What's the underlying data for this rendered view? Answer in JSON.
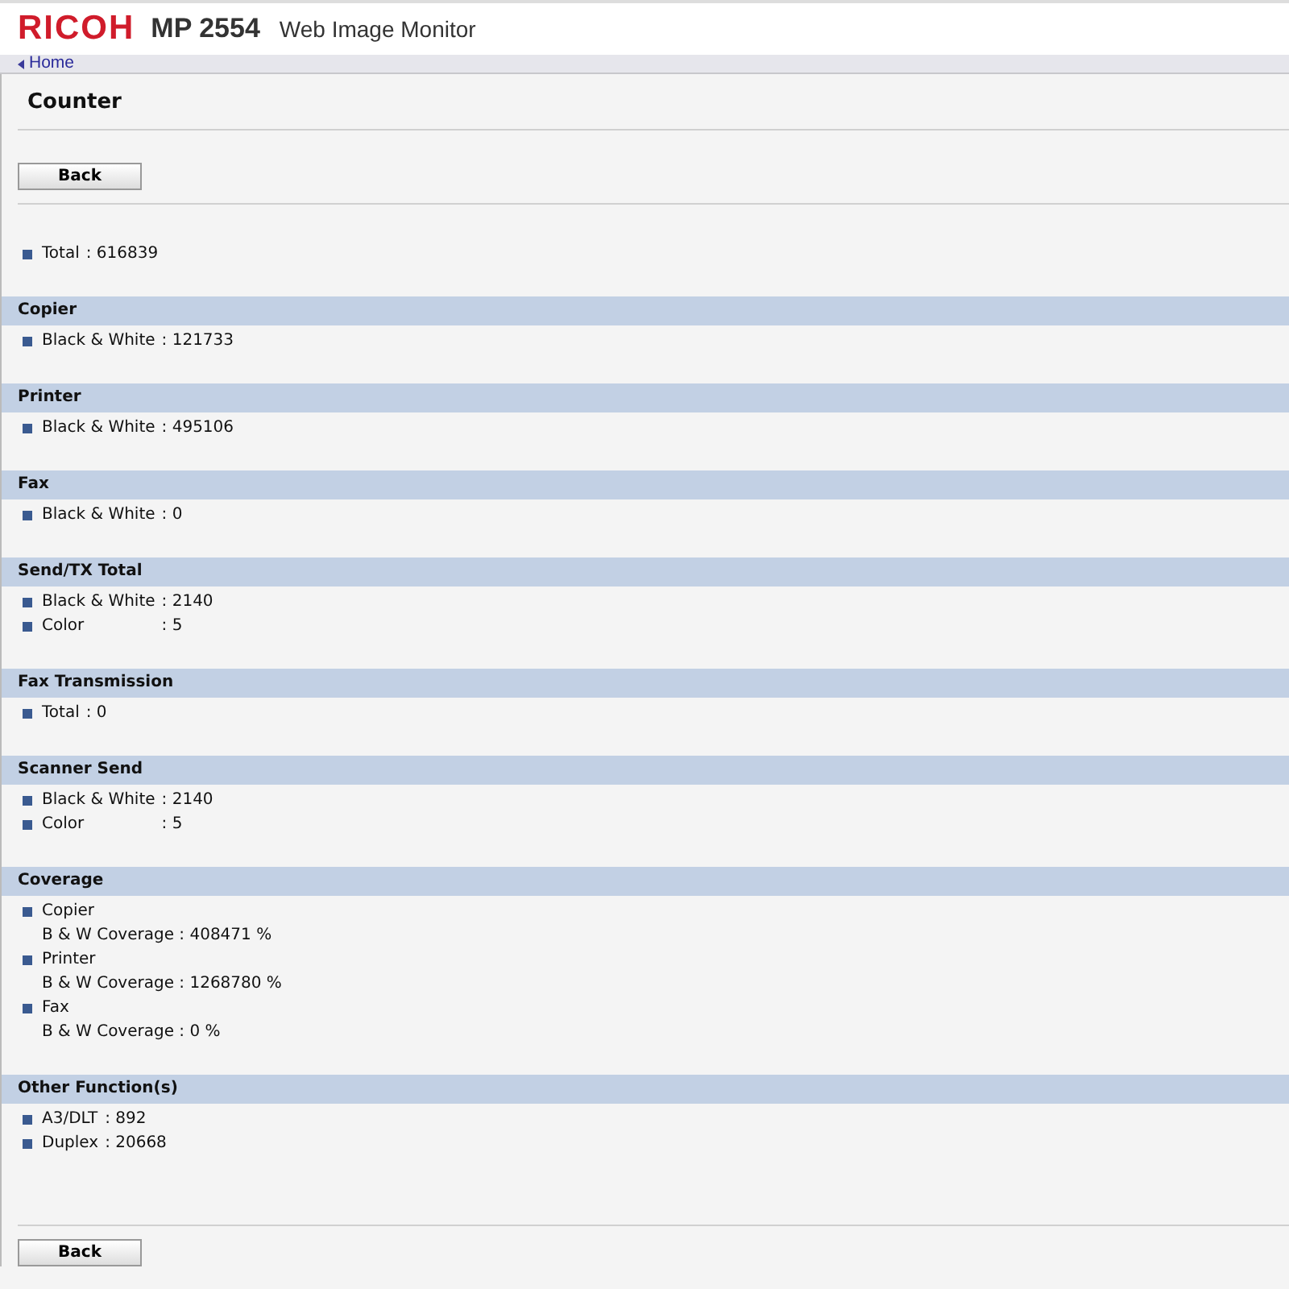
{
  "header": {
    "brand": "RICOH",
    "model": "MP 2554",
    "product": "Web Image Monitor"
  },
  "breadcrumb": {
    "link": "Home"
  },
  "page_title": "Counter",
  "back_button": "Back",
  "total": {
    "label": "Total",
    "value": ": 616839"
  },
  "sections": [
    {
      "title": "Copier",
      "items": [
        {
          "kind": "counter",
          "label": "Black & White",
          "value": ": 121733"
        }
      ]
    },
    {
      "title": "Printer",
      "items": [
        {
          "kind": "counter",
          "label": "Black & White",
          "value": ": 495106"
        }
      ]
    },
    {
      "title": "Fax",
      "items": [
        {
          "kind": "counter",
          "label": "Black & White",
          "value": ": 0"
        }
      ]
    },
    {
      "title": "Send/TX Total",
      "items": [
        {
          "kind": "counter",
          "label": "Black & White",
          "value": ": 2140"
        },
        {
          "kind": "counter",
          "label": "Color",
          "value": ": 5"
        }
      ]
    },
    {
      "title": "Fax Transmission",
      "items": [
        {
          "kind": "counter",
          "label": "Total",
          "value": ": 0"
        }
      ]
    },
    {
      "title": "Scanner Send",
      "items": [
        {
          "kind": "counter",
          "label": "Black & White",
          "value": ": 2140"
        },
        {
          "kind": "counter",
          "label": "Color",
          "value": ": 5"
        }
      ]
    },
    {
      "title": "Coverage",
      "items": [
        {
          "kind": "coverage",
          "label": "Copier",
          "detail": "B & W Coverage : 408471 %"
        },
        {
          "kind": "coverage",
          "label": "Printer",
          "detail": "B & W Coverage : 1268780 %"
        },
        {
          "kind": "coverage",
          "label": "Fax",
          "detail": "B & W Coverage : 0 %"
        }
      ]
    },
    {
      "title": "Other Function(s)",
      "items": [
        {
          "kind": "counter",
          "label": "A3/DLT",
          "value": ": 892"
        },
        {
          "kind": "counter",
          "label": "Duplex",
          "value": ": 20668"
        }
      ]
    }
  ],
  "bottom_button": "Back"
}
